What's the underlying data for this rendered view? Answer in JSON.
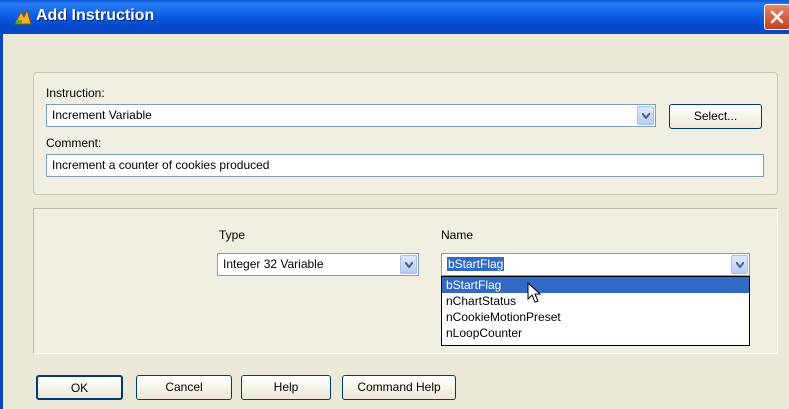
{
  "window": {
    "title": "Add Instruction"
  },
  "instruction": {
    "label": "Instruction:",
    "value": "Increment Variable",
    "select_button": "Select..."
  },
  "comment": {
    "label": "Comment:",
    "value": "Increment a counter of cookies produced"
  },
  "type": {
    "label": "Type",
    "value": "Integer 32 Variable"
  },
  "name": {
    "label": "Name",
    "value": "bStartFlag",
    "options": [
      "bStartFlag",
      "nChartStatus",
      "nCookieMotionPreset",
      "nLoopCounter"
    ],
    "highlighted_index": 0
  },
  "buttons": {
    "ok": "OK",
    "cancel": "Cancel",
    "help": "Help",
    "command_help": "Command Help"
  },
  "colors": {
    "titlebar": "#0a57d8",
    "selection": "#316ac5",
    "dialog_bg": "#ece9d8"
  }
}
